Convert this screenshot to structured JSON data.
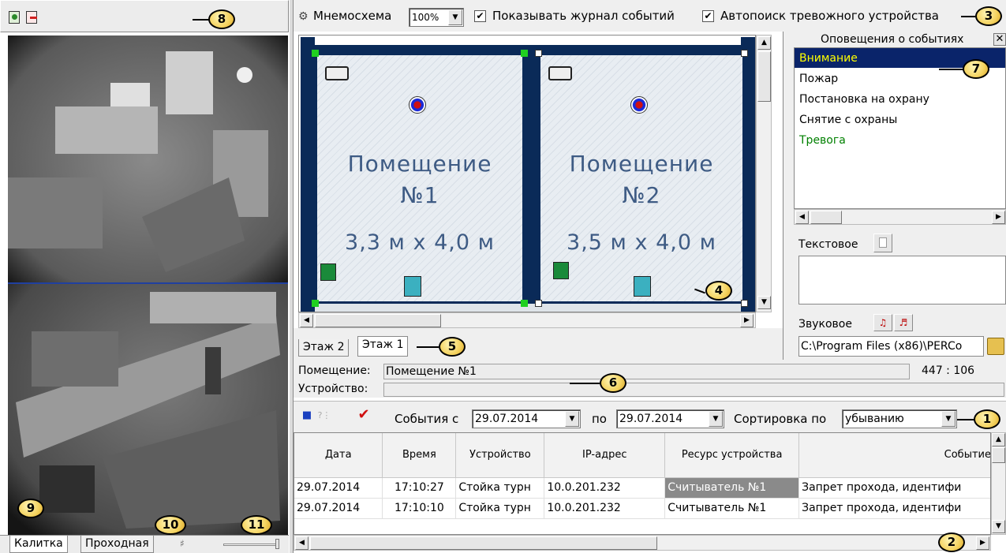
{
  "left_panel": {
    "tabs": [
      "Калитка",
      "Проходная"
    ]
  },
  "toolbar": {
    "scheme_label": "Мнемосхема",
    "zoom_value": "100%",
    "show_log_label": "Показывать журнал событий",
    "show_log_checked": true,
    "autosearch_label": "Автопоиск тревожного устройства",
    "autosearch_checked": true
  },
  "floorplan": {
    "rooms": [
      {
        "title_line1": "Помещение",
        "title_line2": "№1",
        "dimensions": "3,3 м х 4,0 м"
      },
      {
        "title_line1": "Помещение",
        "title_line2": "№2",
        "dimensions": "3,5 м х 4,0 м"
      }
    ],
    "floor_tabs": [
      "Этаж 2",
      "Этаж 1"
    ],
    "active_floor_tab": "Этаж 1"
  },
  "notifications": {
    "title": "Оповещения о событиях",
    "items": [
      {
        "label": "Внимание",
        "color": "#ffff00",
        "selected": true
      },
      {
        "label": "Пожар",
        "color": "#000000"
      },
      {
        "label": "Постановка на охрану",
        "color": "#000000"
      },
      {
        "label": "Снятие с охраны",
        "color": "#000000"
      },
      {
        "label": "Тревога",
        "color": "#008000"
      }
    ],
    "text_label": "Текстовое",
    "sound_label": "Звуковое",
    "sound_path": "C:\\Program Files (x86)\\PERCo"
  },
  "status": {
    "room_label": "Помещение:",
    "room_value": "Помещение №1",
    "coords": "447 : 106",
    "device_label": "Устройство:",
    "device_value": ""
  },
  "events_filter": {
    "from_label": "События с",
    "from_date": "29.07.2014",
    "to_label": "по",
    "to_date": "29.07.2014",
    "sort_label": "Сортировка по",
    "sort_value": "убыванию"
  },
  "events_table": {
    "columns": [
      "Дата",
      "Время",
      "Устройство",
      "IP-адрес",
      "Ресурс устройства",
      "Событие"
    ],
    "rows": [
      [
        "29.07.2014",
        "17:10:27",
        "Стойка турн",
        "10.0.201.232",
        "Считыватель №1",
        "Запрет прохода, идентифи"
      ],
      [
        "29.07.2014",
        "17:10:10",
        "Стойка турн",
        "10.0.201.232",
        "Считыватель №1",
        "Запрет прохода, идентифи"
      ]
    ]
  },
  "callouts": [
    "1",
    "2",
    "3",
    "4",
    "5",
    "6",
    "7",
    "8",
    "9",
    "10",
    "11"
  ]
}
